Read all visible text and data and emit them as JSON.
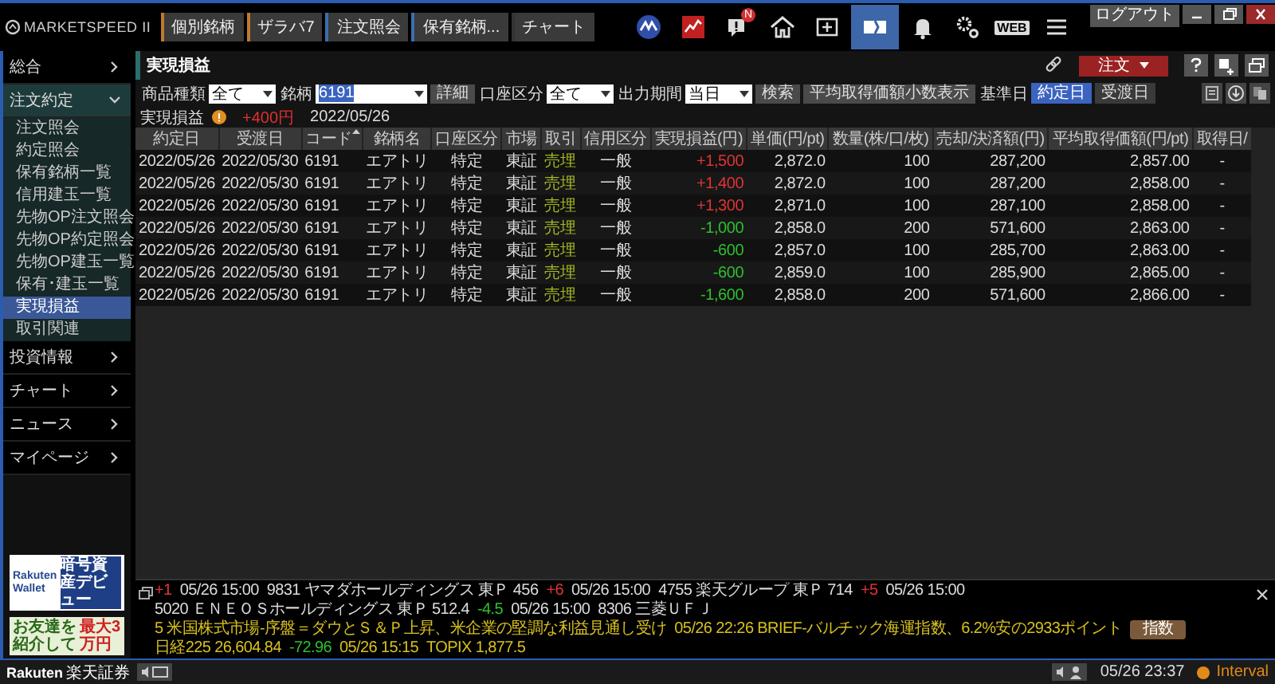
{
  "logo": "MARKETSPEED II",
  "nav_buttons": [
    {
      "label": "個別銘柄",
      "color": "#c07a30"
    },
    {
      "label": "ザラバ7",
      "color": "#c07a30"
    },
    {
      "label": "注文照会",
      "color": "#3a6fb0"
    },
    {
      "label": "保有銘柄...",
      "color": "#3a6fb0"
    },
    {
      "label": "チャート",
      "color": "#333333"
    }
  ],
  "toolbar_icons": [
    {
      "kind": "wave",
      "selected": false
    },
    {
      "kind": "redchart",
      "selected": false
    },
    {
      "kind": "alert",
      "badge": "N",
      "selected": false
    },
    {
      "kind": "home",
      "selected": false
    },
    {
      "kind": "screen",
      "selected": false
    },
    {
      "kind": "panel",
      "selected": true
    },
    {
      "kind": "bell",
      "selected": false
    },
    {
      "kind": "gears",
      "selected": false
    },
    {
      "kind": "web",
      "label": "WEB",
      "selected": false
    },
    {
      "kind": "menu",
      "selected": false
    }
  ],
  "window_controls": {
    "logout": "ログアウト"
  },
  "sidebar": {
    "items": [
      {
        "label": "総合",
        "expanded": false
      },
      {
        "label": "注文約定",
        "expanded": true,
        "children": [
          {
            "label": "注文照会",
            "selected": false
          },
          {
            "label": "約定照会",
            "selected": false
          },
          {
            "label": "保有銘柄一覧",
            "selected": false
          },
          {
            "label": "信用建玉一覧",
            "selected": false
          },
          {
            "label": "先物OP注文照会",
            "selected": false
          },
          {
            "label": "先物OP約定照会",
            "selected": false
          },
          {
            "label": "先物OP建玉一覧",
            "selected": false
          },
          {
            "label": "保有･建玉一覧",
            "selected": false
          },
          {
            "label": "実現損益",
            "selected": true
          },
          {
            "label": "取引関連",
            "selected": false
          }
        ]
      },
      {
        "label": "投資情報",
        "expanded": false
      },
      {
        "label": "チャート",
        "expanded": false
      },
      {
        "label": "ニュース",
        "expanded": false
      },
      {
        "label": "マイページ",
        "expanded": false
      }
    ],
    "banners": [
      {
        "kind": "wallet",
        "brand": "Rakuten",
        "brand_sub": "Wallet",
        "text": "暗号資産デビュー"
      },
      {
        "kind": "referral",
        "text": "お友達を紹介して",
        "highlight": "最大3万円"
      }
    ]
  },
  "panel": {
    "title": "実現損益",
    "order_button": "注文",
    "filters": [
      {
        "kind": "select",
        "label": "商品種類",
        "value": "全て"
      },
      {
        "kind": "select",
        "label": "銘柄",
        "value": "6191",
        "highlighted": true
      },
      {
        "kind": "button",
        "label": "詳細"
      },
      {
        "kind": "select",
        "label": "口座区分",
        "value": "全て"
      },
      {
        "kind": "select",
        "label": "出力期間",
        "value": "当日"
      },
      {
        "kind": "button",
        "label": "検索"
      },
      {
        "kind": "button",
        "label": "平均取得価額小数表示"
      },
      {
        "kind": "label",
        "label": "基準日"
      },
      {
        "kind": "toggle",
        "label": "約定日",
        "selected": true
      },
      {
        "kind": "toggle",
        "label": "受渡日",
        "selected": false
      }
    ],
    "summary": {
      "label": "実現損益",
      "total": "+400円",
      "date": "2022/05/26"
    },
    "table": {
      "columns": [
        {
          "label": "約定日",
          "sorted": false
        },
        {
          "label": "受渡日",
          "sorted": false
        },
        {
          "label": "コード",
          "sorted": true
        },
        {
          "label": "銘柄名",
          "sorted": false
        },
        {
          "label": "口座区分",
          "sorted": false
        },
        {
          "label": "市場",
          "sorted": false
        },
        {
          "label": "取引",
          "sorted": false
        },
        {
          "label": "信用区分",
          "sorted": false
        },
        {
          "label": "実現損益(円)",
          "sorted": false
        },
        {
          "label": "単価(円/pt)",
          "sorted": false
        },
        {
          "label": "数量(株/口/枚)",
          "sorted": false
        },
        {
          "label": "売却/決済額(円)",
          "sorted": false
        },
        {
          "label": "平均取得価額(円/pt)",
          "sorted": false
        },
        {
          "label": "取得日/",
          "sorted": false
        }
      ],
      "rows": [
        {
          "kind": "gain",
          "cells": [
            "2022/05/26",
            "2022/05/30",
            "6191",
            "エアトリ",
            "特定",
            "東証",
            "売埋",
            "一般",
            "+1,500",
            "2,872.0",
            "100",
            "287,200",
            "2,857.00",
            "-"
          ]
        },
        {
          "kind": "gain",
          "cells": [
            "2022/05/26",
            "2022/05/30",
            "6191",
            "エアトリ",
            "特定",
            "東証",
            "売埋",
            "一般",
            "+1,400",
            "2,872.0",
            "100",
            "287,200",
            "2,858.00",
            "-"
          ]
        },
        {
          "kind": "gain",
          "cells": [
            "2022/05/26",
            "2022/05/30",
            "6191",
            "エアトリ",
            "特定",
            "東証",
            "売埋",
            "一般",
            "+1,300",
            "2,871.0",
            "100",
            "287,100",
            "2,858.00",
            "-"
          ]
        },
        {
          "kind": "loss",
          "cells": [
            "2022/05/26",
            "2022/05/30",
            "6191",
            "エアトリ",
            "特定",
            "東証",
            "売埋",
            "一般",
            "-1,000",
            "2,858.0",
            "200",
            "571,600",
            "2,863.00",
            "-"
          ]
        },
        {
          "kind": "loss",
          "cells": [
            "2022/05/26",
            "2022/05/30",
            "6191",
            "エアトリ",
            "特定",
            "東証",
            "売埋",
            "一般",
            "-600",
            "2,857.0",
            "100",
            "285,700",
            "2,863.00",
            "-"
          ]
        },
        {
          "kind": "loss",
          "cells": [
            "2022/05/26",
            "2022/05/30",
            "6191",
            "エアトリ",
            "特定",
            "東証",
            "売埋",
            "一般",
            "-600",
            "2,859.0",
            "100",
            "285,900",
            "2,865.00",
            "-"
          ]
        },
        {
          "kind": "loss",
          "cells": [
            "2022/05/26",
            "2022/05/30",
            "6191",
            "エアトリ",
            "特定",
            "東証",
            "売埋",
            "一般",
            "-1,600",
            "2,858.0",
            "200",
            "571,600",
            "2,866.00",
            "-"
          ]
        }
      ]
    }
  },
  "ticker": {
    "lines": [
      [
        {
          "kind": "up",
          "text": "+1"
        },
        {
          "kind": "plain",
          "text": "05/26 15:00"
        },
        {
          "kind": "plain",
          "text": "9831 ヤマダホールディングス 東Ｐ 456"
        },
        {
          "kind": "up",
          "text": "+6"
        },
        {
          "kind": "plain",
          "text": "05/26 15:00"
        },
        {
          "kind": "plain",
          "text": "4755 楽天グループ 東Ｐ 714"
        },
        {
          "kind": "up",
          "text": "+5"
        },
        {
          "kind": "plain",
          "text": "05/26 15:00"
        },
        {
          "kind": "plain",
          "text": "5020 ＥＮＥＯＳホールディングス 東Ｐ 512.4"
        },
        {
          "kind": "down",
          "text": "-4.5"
        },
        {
          "kind": "plain",
          "text": "05/26 15:00"
        },
        {
          "kind": "plain",
          "text": "8306 三菱ＵＦＪ"
        }
      ],
      [
        {
          "kind": "news",
          "text": "5 米国株式市場-序盤＝ダウとＳ＆Ｐ上昇、米企業の堅調な利益見通し受け"
        },
        {
          "kind": "news",
          "text": "05/26 22:26 BRIEF-バルチック海運指数、6.2%安の2933ポイント"
        },
        {
          "kind": "badge",
          "text": "指数"
        },
        {
          "kind": "news",
          "text": "日経225 26,604.84"
        },
        {
          "kind": "down",
          "text": "-72.96"
        },
        {
          "kind": "news",
          "text": "05/26 15:15"
        },
        {
          "kind": "news",
          "text": "TOPIX 1,877.5"
        }
      ]
    ]
  },
  "status_bar": {
    "brand": "Rakuten",
    "brand_sub": "楽天証券",
    "time": "05/26 23:37",
    "mode": "Interval"
  }
}
